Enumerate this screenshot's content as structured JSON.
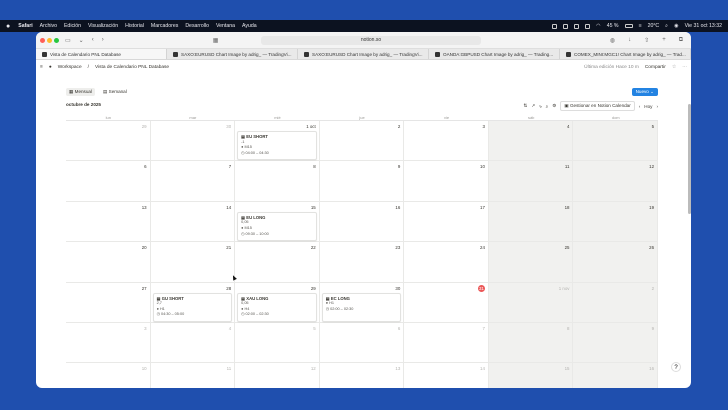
{
  "menubar": {
    "items": [
      "Safari",
      "Archivo",
      "Edición",
      "Visualización",
      "Historial",
      "Marcadores",
      "Desarrollo",
      "Ventana",
      "Ayuda"
    ],
    "battery": "45 %",
    "temp": "20°C",
    "clock": "Vie 31 oct 13:32"
  },
  "browser": {
    "url": "notion.so",
    "tabs": [
      "Vista de Calendario PNL Database",
      "SAXO:EURUSD Chart Image by adrig_ — TradingVi...",
      "SAXO:EURUSD Chart Image by adrig_ — TradingVi...",
      "OANDA:GBPUSD Chart Image by adrig_ — Trading...",
      "COMEX_MINI:MGC1! Chart Image by adrig_ — Trad..."
    ]
  },
  "notion": {
    "breadcrumb": [
      "Workspace",
      "Vista de Calendario PNL Database"
    ],
    "last_edit": "Última edición Hace 10 m",
    "share": "Compartir"
  },
  "calendar": {
    "view_monthly": "Mensual",
    "view_weekly": "Semanal",
    "new_button": "Nuevo",
    "month_title": "octubre de 2025",
    "gcal_button": "Gestionar en Notion Calendar",
    "today_button": "Hoy",
    "dow": [
      "lun",
      "mar",
      "mié",
      "jue",
      "vie",
      "sáb",
      "dom"
    ],
    "weeks": [
      [
        "29",
        "30",
        "1 oct",
        "2",
        "3",
        "4",
        "5"
      ],
      [
        "6",
        "7",
        "8",
        "9",
        "10",
        "11",
        "12"
      ],
      [
        "13",
        "14",
        "15",
        "16",
        "17",
        "18",
        "19"
      ],
      [
        "20",
        "21",
        "22",
        "23",
        "24",
        "25",
        "26"
      ],
      [
        "27",
        "28",
        "29",
        "30",
        "31",
        "1 nov",
        "2"
      ],
      [
        "3",
        "4",
        "5",
        "6",
        "7",
        "8",
        "9"
      ],
      [
        "10",
        "11",
        "12",
        "13",
        "14",
        "15",
        "16"
      ]
    ],
    "events": {
      "w0d2": {
        "title": "EU SHORT",
        "l1": "-1",
        "l2": "M15",
        "l3": "04:00 – 04:30"
      },
      "w2d2": {
        "title": "EU LONG",
        "l1": "0,05",
        "l2": "M15",
        "l3": "09:30 – 10:00"
      },
      "w4d1": {
        "title": "GU SHORT",
        "l1": "2,7",
        "l2": "H1",
        "l3": "04:30 – 05:00"
      },
      "w4d2": {
        "title": "XAU LONG",
        "l1": "0,05",
        "l2": "H4",
        "l3": "02:00 – 02:30"
      },
      "w4d3": {
        "title": "EC LONG",
        "l1": "",
        "l2": "H1",
        "l3": "02:00 – 02:30"
      }
    }
  },
  "colors": {
    "accent": "#2383e2",
    "today": "#eb5757",
    "weekend": "#f1f1ef",
    "desktop": "#1f4fae"
  }
}
